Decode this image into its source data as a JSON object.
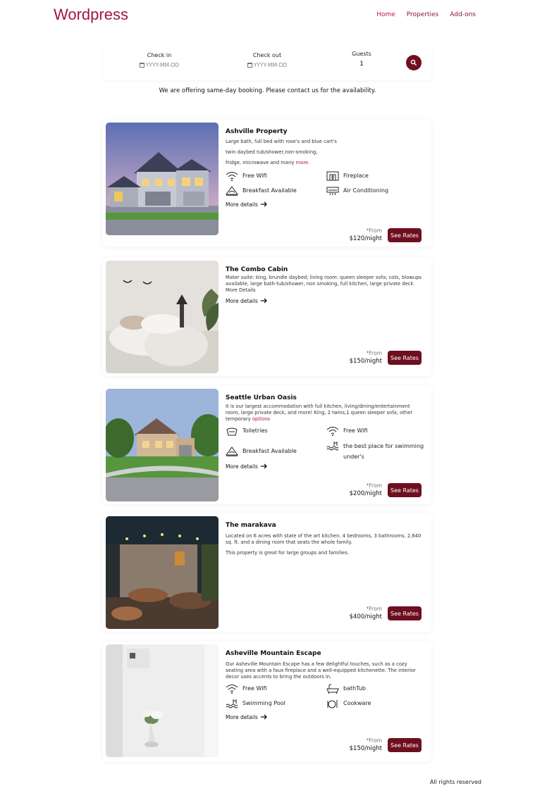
{
  "brand": {
    "logo": "Wordpress",
    "accent": "#a4124c",
    "button_color": "#6e0f1f"
  },
  "nav": {
    "items": [
      "Home",
      "Properties",
      "Add-ons"
    ]
  },
  "search": {
    "checkin_label": "Check in",
    "checkin_placeholder": "YYYY-MM-DD",
    "checkout_label": "Check out",
    "checkout_placeholder": "YYYY-MM-DD",
    "guests_label": "Guests",
    "guests_value": "1",
    "search_icon": "magnifier-icon"
  },
  "notice": "We are offering same-day booking. Please contact us for the availability.",
  "properties": [
    {
      "title": "Ashville Property",
      "description": [
        "Large bath, full bed with rose's and blue cart's",
        "twin daybed tub/shower,non-smoking,",
        "fridge, microwave and many "
      ],
      "more": "more.",
      "amenities": [
        {
          "icon": "wifi-icon",
          "label": "Free Wifi"
        },
        {
          "icon": "fireplace-icon",
          "label": "Fireplace"
        },
        {
          "icon": "breakfast-icon",
          "label": "Breakfast Available"
        },
        {
          "icon": "air-conditioning-icon",
          "label": "Air Conditioning"
        }
      ],
      "details_label": "More details",
      "from": "*From",
      "price": "$120/night",
      "button": "See Rates"
    },
    {
      "title": "The Combo Cabin",
      "description": [
        "Mater suite: king, brundle daybed; living room: queen sleeper sofa; cots, blowups available, large bath-tub/shower, non smoking, full kitchen, large private deck More Details"
      ],
      "more": "",
      "amenities": [],
      "details_label": "More details",
      "from": "*From",
      "price": "$150/night",
      "button": "See Rates"
    },
    {
      "title": "Seattle Urban Oasis",
      "description": [
        "It is our largest accommodation with full kitchen, living/dining/entertainment room, large private deck, and more! King, 2 twins,1 queen sleeper sofa, other temporary "
      ],
      "more": "options",
      "amenities": [
        {
          "icon": "toiletries-icon",
          "label": "Toiletries"
        },
        {
          "icon": "wifi-icon",
          "label": "Free Wifi"
        },
        {
          "icon": "breakfast-icon",
          "label": "Breakfast Available"
        },
        {
          "icon": "swimming-icon",
          "label": "the best place for swimming under's"
        }
      ],
      "details_label": "More details",
      "from": "*From",
      "price": "$200/night",
      "button": "See Rates"
    },
    {
      "title": "The marakava",
      "description": [
        "Located on 6 acres with state of the art kitchen, 4 bedrooms, 3 bathrooms, 2,640 sq. ft. and a dining room that seats the whole family.",
        "This property is great for large groups and families."
      ],
      "more": "",
      "amenities": [],
      "details_label": "",
      "from": "*From",
      "price": "$400/night",
      "button": "See Rates"
    },
    {
      "title": "Asheville Mountain Escape",
      "description": [
        "Our Asheville Mountain Escape has a few delightful touches, such as a cozy seating area with a faux fireplace and a well-equipped kitchenette. The interior decor uses accents to bring the outdoors in."
      ],
      "more": "",
      "amenities": [
        {
          "icon": "wifi-icon",
          "label": "Free Wifi"
        },
        {
          "icon": "bathtub-icon",
          "label": "bathTub"
        },
        {
          "icon": "swimming-icon",
          "label": "Swimming Pool"
        },
        {
          "icon": "cookware-icon",
          "label": "Cookware"
        }
      ],
      "details_label": "More details",
      "from": "*From",
      "price": "$150/night",
      "button": "See Rates"
    }
  ],
  "footer": "All rights reserved"
}
